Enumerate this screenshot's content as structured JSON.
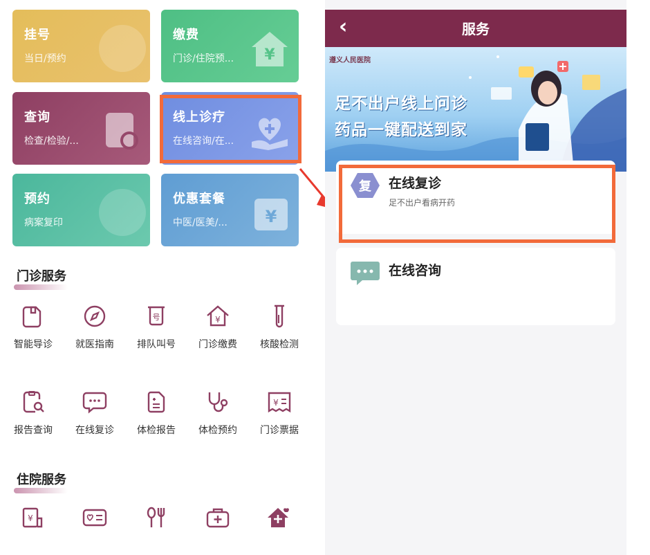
{
  "left": {
    "tiles": [
      {
        "title": "挂号",
        "subtitle": "当日/预约"
      },
      {
        "title": "缴费",
        "subtitle": "门诊/住院预..."
      },
      {
        "title": "查询",
        "subtitle": "检查/检验/..."
      },
      {
        "title": "线上诊疗",
        "subtitle": "在线咨询/在..."
      },
      {
        "title": "预约",
        "subtitle": "病案复印"
      },
      {
        "title": "优惠套餐",
        "subtitle": "中医/医美/..."
      }
    ],
    "outpatient": {
      "title": "门诊服务",
      "items": [
        {
          "label": "智能导诊",
          "icon": "smart-guide-icon"
        },
        {
          "label": "就医指南",
          "icon": "compass-icon"
        },
        {
          "label": "排队叫号",
          "icon": "queue-number-icon"
        },
        {
          "label": "门诊缴费",
          "icon": "payment-house-icon"
        },
        {
          "label": "核酸检测",
          "icon": "test-tube-icon"
        },
        {
          "label": "报告查询",
          "icon": "report-search-icon"
        },
        {
          "label": "在线复诊",
          "icon": "chat-bubble-icon"
        },
        {
          "label": "体检报告",
          "icon": "exam-report-icon"
        },
        {
          "label": "体检预约",
          "icon": "stethoscope-icon"
        },
        {
          "label": "门诊票据",
          "icon": "receipt-icon"
        }
      ]
    },
    "inpatient": {
      "title": "住院服务",
      "icons": [
        "deposit-icon",
        "id-card-icon",
        "meal-icon",
        "medkit-icon",
        "care-house-icon"
      ]
    }
  },
  "right": {
    "header": {
      "title": "服务",
      "back_icon": "back-chevron-icon"
    },
    "banner": {
      "hospital": "遵义人民医院",
      "line1": "足不出户线上问诊",
      "line2": "药品一键配送到家"
    },
    "services": [
      {
        "icon_char": "复",
        "title": "在线复诊",
        "subtitle": "足不出户看病开药"
      },
      {
        "icon_char": "···",
        "title": "在线咨询",
        "subtitle": ""
      }
    ]
  },
  "colors": {
    "header": "#7d2a4c",
    "highlight": "#f26a3a",
    "icon_purple": "#8e3f62"
  }
}
